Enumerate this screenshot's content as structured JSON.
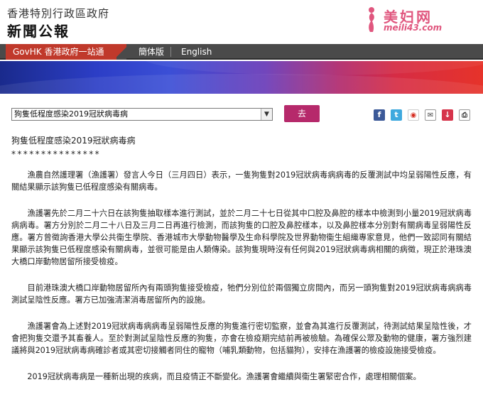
{
  "header": {
    "gov_name": "香港特別行政區政府",
    "press_title": "新聞公報"
  },
  "watermark": {
    "cn_text": "美妇网",
    "url": "meili43.com"
  },
  "nav": {
    "govhk": "GovHK 香港政府一站通",
    "simplified": "簡体版",
    "english": "English"
  },
  "toolbar": {
    "select_value": "狗隻低程度感染2019冠狀病毒病",
    "go_label": "去",
    "share_icons": [
      "facebook-icon",
      "twitter-icon",
      "weibo-icon",
      "email-icon",
      "download-icon",
      "print-icon"
    ]
  },
  "article": {
    "title": "狗隻低程度感染2019冠狀病毒病",
    "stars": "***************",
    "paragraphs": [
      "　　漁農自然護理署（漁護署）發言人今日（三月四日）表示，一隻狗隻對2019冠狀病毒病病毒的反覆測試中均呈弱陽性反應，有關結果顯示該狗隻已低程度感染有關病毒。",
      "　　漁護署先於二月二十六日在該狗隻抽取樣本進行測試，並於二月二十七日從其中口腔及鼻腔的樣本中檢測到小量2019冠狀病毒病病毒。署方分別於二月二十八日及三月二日再進行檢測，而該狗隻的口腔及鼻腔樣本，以及鼻腔樣本分別對有關病毒呈弱陽性反應。署方曾徵詢香港大學公共衞生學院、香港城市大學動物醫學及生命科學院及世界動物衞生組織專家意見，他們一致認同有關結果顯示該狗隻已低程度感染有關病毒，並很可能是由人類傳染。該狗隻現時沒有任何與2019冠狀病毒病相關的病徵，現正於港珠澳大橋口岸動物居留所接受檢疫。",
      "　　目前港珠澳大橋口岸動物居留所內有兩頭狗隻接受檢疫，牠們分別位於兩個獨立房間內，而另一頭狗隻對2019冠狀病毒病病毒測試呈陰性反應。署方已加強清潔消毒居留所內的設施。",
      "　　漁護署會為上述對2019冠狀病毒病病毒呈弱陽性反應的狗隻進行密切監察，並會為其進行反覆測試，待測試結果呈陰性後，才會把狗隻交還予其畜養人。至於對測試呈陰性反應的狗隻，亦會在檢疫期完結前再被檢驗。為確保公眾及動物的健康，署方強烈建議將與2019冠狀病毒病確診者或其密切接觸者同住的寵物（哺乳類動物，包括貓狗），安排在漁護署的檢疫設施接受檢疫。",
      "　　2019冠狀病毒病是一種新出現的疾病，而且疫情正不斷變化。漁護署會繼續與衞生署緊密合作，處理相關個案。"
    ]
  }
}
